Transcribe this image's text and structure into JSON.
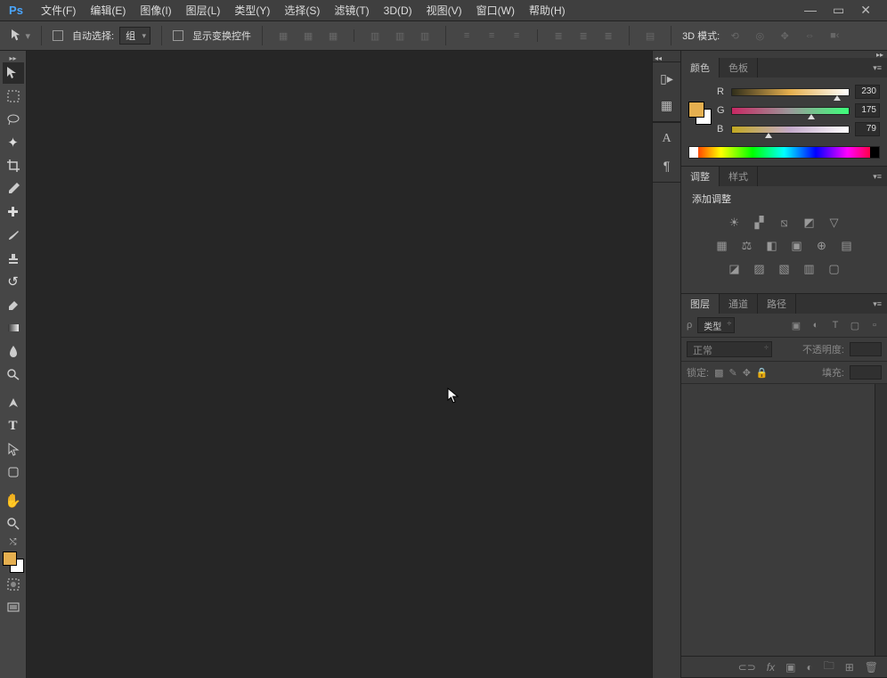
{
  "app": {
    "logo": "Ps"
  },
  "menu": [
    {
      "label": "文件(F)"
    },
    {
      "label": "编辑(E)"
    },
    {
      "label": "图像(I)"
    },
    {
      "label": "图层(L)"
    },
    {
      "label": "类型(Y)"
    },
    {
      "label": "选择(S)"
    },
    {
      "label": "滤镜(T)"
    },
    {
      "label": "3D(D)"
    },
    {
      "label": "视图(V)"
    },
    {
      "label": "窗口(W)"
    },
    {
      "label": "帮助(H)"
    }
  ],
  "options": {
    "auto_select": "自动选择:",
    "group_select": "组",
    "show_transform": "显示变换控件",
    "mode3d": "3D 模式:"
  },
  "panels": {
    "color": {
      "tab1": "颜色",
      "tab2": "色板",
      "labels": {
        "r": "R",
        "g": "G",
        "b": "B"
      },
      "values": {
        "r": "230",
        "g": "175",
        "b": "79"
      },
      "pos": {
        "r": 90,
        "g": 68,
        "b": 31
      }
    },
    "adjust": {
      "tab1": "调整",
      "tab2": "样式",
      "title": "添加调整"
    },
    "layers": {
      "tab1": "图层",
      "tab2": "通道",
      "tab3": "路径",
      "kind": "类型",
      "blend": "正常",
      "opacity_label": "不透明度:",
      "lock_label": "锁定:",
      "fill_label": "填充:"
    }
  }
}
